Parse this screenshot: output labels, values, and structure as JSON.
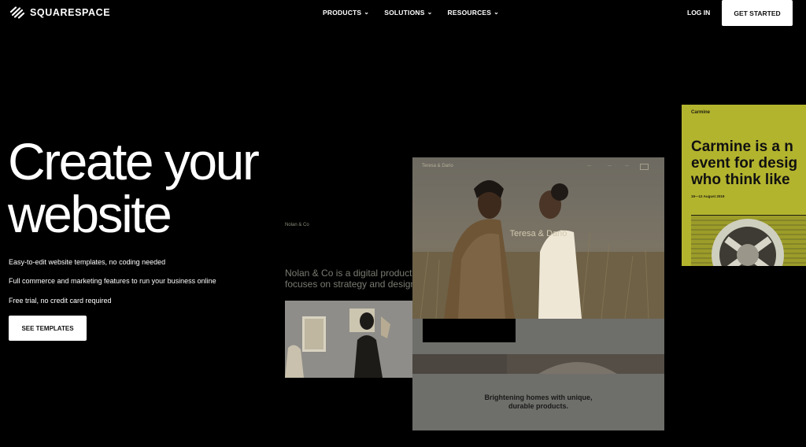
{
  "header": {
    "brand": "SQUARESPACE",
    "nav": [
      {
        "label": "PRODUCTS"
      },
      {
        "label": "SOLUTIONS"
      },
      {
        "label": "RESOURCES"
      }
    ],
    "login": "LOG IN",
    "cta": "GET STARTED"
  },
  "hero": {
    "title_line1": "Create your",
    "title_line2": "website",
    "features": [
      "Easy-to-edit website templates, no coding needed",
      "Full commerce and marketing features to run your business online",
      "Free trial, no credit card required"
    ],
    "cta": "SEE TEMPLATES"
  },
  "templates": {
    "nolan": {
      "name": "Nolan & Co",
      "text": "Nolan & Co is a digital product a",
      "text2": "focuses on strategy and design."
    },
    "teresa": {
      "small_name": "Teresa & Dario",
      "title": "Teresa & Dario",
      "text_line1": "Brightening homes with unique,",
      "text_line2": "durable products."
    },
    "carmine": {
      "name": "Carmine",
      "title_line1": "Carmine is a n",
      "title_line2": "event for desig",
      "title_line3": "who think like",
      "date": "19—12 August 2019"
    }
  },
  "colors": {
    "background": "#000000",
    "button": "#ffffff",
    "carmine_accent": "#b3b42e"
  }
}
